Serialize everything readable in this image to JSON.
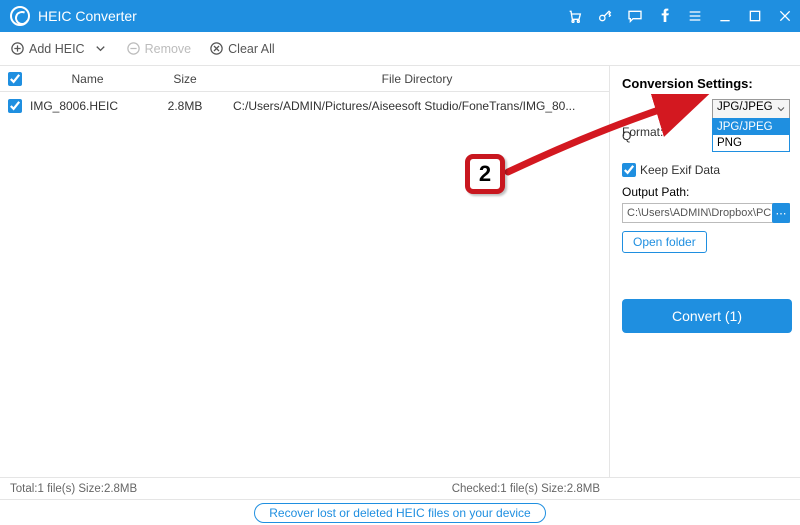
{
  "app": {
    "title": "HEIC Converter"
  },
  "toolbar": {
    "add_label": "Add HEIC",
    "remove_label": "Remove",
    "clear_label": "Clear All"
  },
  "columns": {
    "name": "Name",
    "size": "Size",
    "dir": "File Directory"
  },
  "files": [
    {
      "checked": true,
      "name": "IMG_8006.HEIC",
      "size": "2.8MB",
      "dir": "C:/Users/ADMIN/Pictures/Aiseesoft Studio/FoneTrans/IMG_80..."
    }
  ],
  "settings": {
    "heading": "Conversion Settings:",
    "format_label": "Format:",
    "format_value": "JPG/JPEG",
    "format_options": [
      "JPG/JPEG",
      "PNG"
    ],
    "quality_label": "Q",
    "keep_exif_label": "Keep Exif Data",
    "keep_exif_checked": true,
    "output_label": "Output Path:",
    "output_value": "C:\\Users\\ADMIN\\Dropbox\\PC\\",
    "open_folder_label": "Open folder",
    "convert_label": "Convert (1)"
  },
  "status": {
    "left": "Total:1 file(s) Size:2.8MB",
    "right": "Checked:1 file(s) Size:2.8MB"
  },
  "footer_link": "Recover lost or deleted HEIC files on your device",
  "anno": {
    "step": "2"
  }
}
